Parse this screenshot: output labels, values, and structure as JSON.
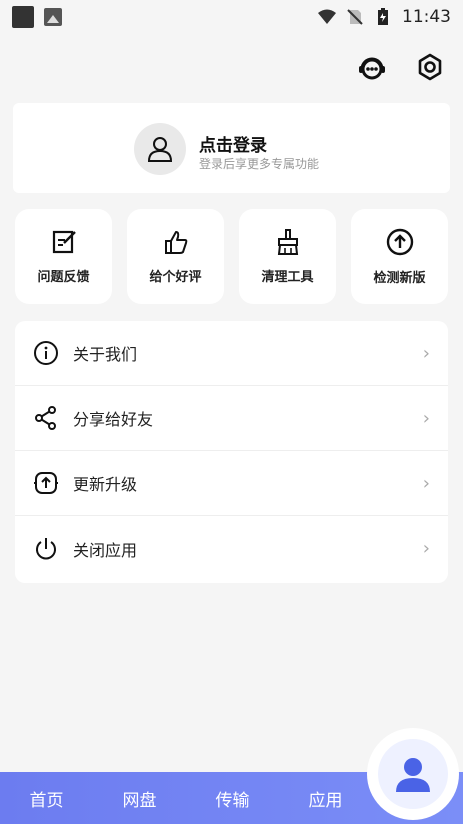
{
  "status_bar": {
    "time": "11:43"
  },
  "top_icons": {
    "support_icon": "headset-icon",
    "settings_icon": "gear-icon"
  },
  "login": {
    "title": "点击登录",
    "subtitle": "登录后享更多专属功能"
  },
  "tools": [
    {
      "label": "问题反馈",
      "icon": "edit-icon"
    },
    {
      "label": "给个好评",
      "icon": "thumbs-up-icon"
    },
    {
      "label": "清理工具",
      "icon": "broom-icon"
    },
    {
      "label": "检测新版",
      "icon": "upload-icon"
    }
  ],
  "menu": [
    {
      "label": "关于我们",
      "icon": "info-icon"
    },
    {
      "label": "分享给好友",
      "icon": "share-icon"
    },
    {
      "label": "更新升级",
      "icon": "update-icon"
    },
    {
      "label": "关闭应用",
      "icon": "power-icon"
    }
  ],
  "tabs": [
    {
      "label": "首页"
    },
    {
      "label": "网盘"
    },
    {
      "label": "传输"
    },
    {
      "label": "应用"
    }
  ],
  "colors": {
    "tabbar": "#7083f3",
    "fab_icon": "#4a63e6"
  }
}
